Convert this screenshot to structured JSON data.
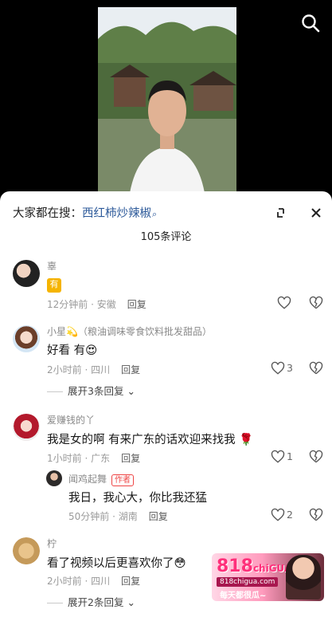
{
  "video": {
    "description_icon": "search-icon"
  },
  "sheet": {
    "search_prefix": "大家都在搜：",
    "search_query": "西红柿炒辣椒",
    "comment_count": "105条评论"
  },
  "comments": [
    {
      "user": "辜",
      "text": "",
      "emoji": "有",
      "time": "12分钟前 · 安徽",
      "reply": "回复",
      "likes": ""
    },
    {
      "user": "小星💫（粮油调味零食饮料批发甜品）",
      "text": "好看 有😍",
      "time": "2小时前 · 四川",
      "reply": "回复",
      "likes": "3",
      "expand": "展开3条回复"
    },
    {
      "user": "爱赚钱的丫",
      "text": "我是女的啊 有来广东的话欢迎来找我 🌹",
      "time": "1小时前 · 广东",
      "reply": "回复",
      "likes": "1"
    },
    {
      "user": "闻鸡起舞",
      "tag": "作者",
      "text": "我日，我心大，你比我还猛",
      "time": "50分钟前 · 湖南",
      "reply": "回复",
      "likes": "2"
    },
    {
      "user": "柠",
      "text": "看了视频以后更喜欢你了😳",
      "time": "2小时前 · 四川",
      "reply": "回复",
      "expand": "展开2条回复"
    }
  ],
  "ad": {
    "brand": "818",
    "brand_suffix": "chiGUA",
    "site": "818chigua.com",
    "slogan": "每天都很瓜~"
  },
  "colors": {
    "accent": "#2d5a9a",
    "tag": "#e44444"
  }
}
